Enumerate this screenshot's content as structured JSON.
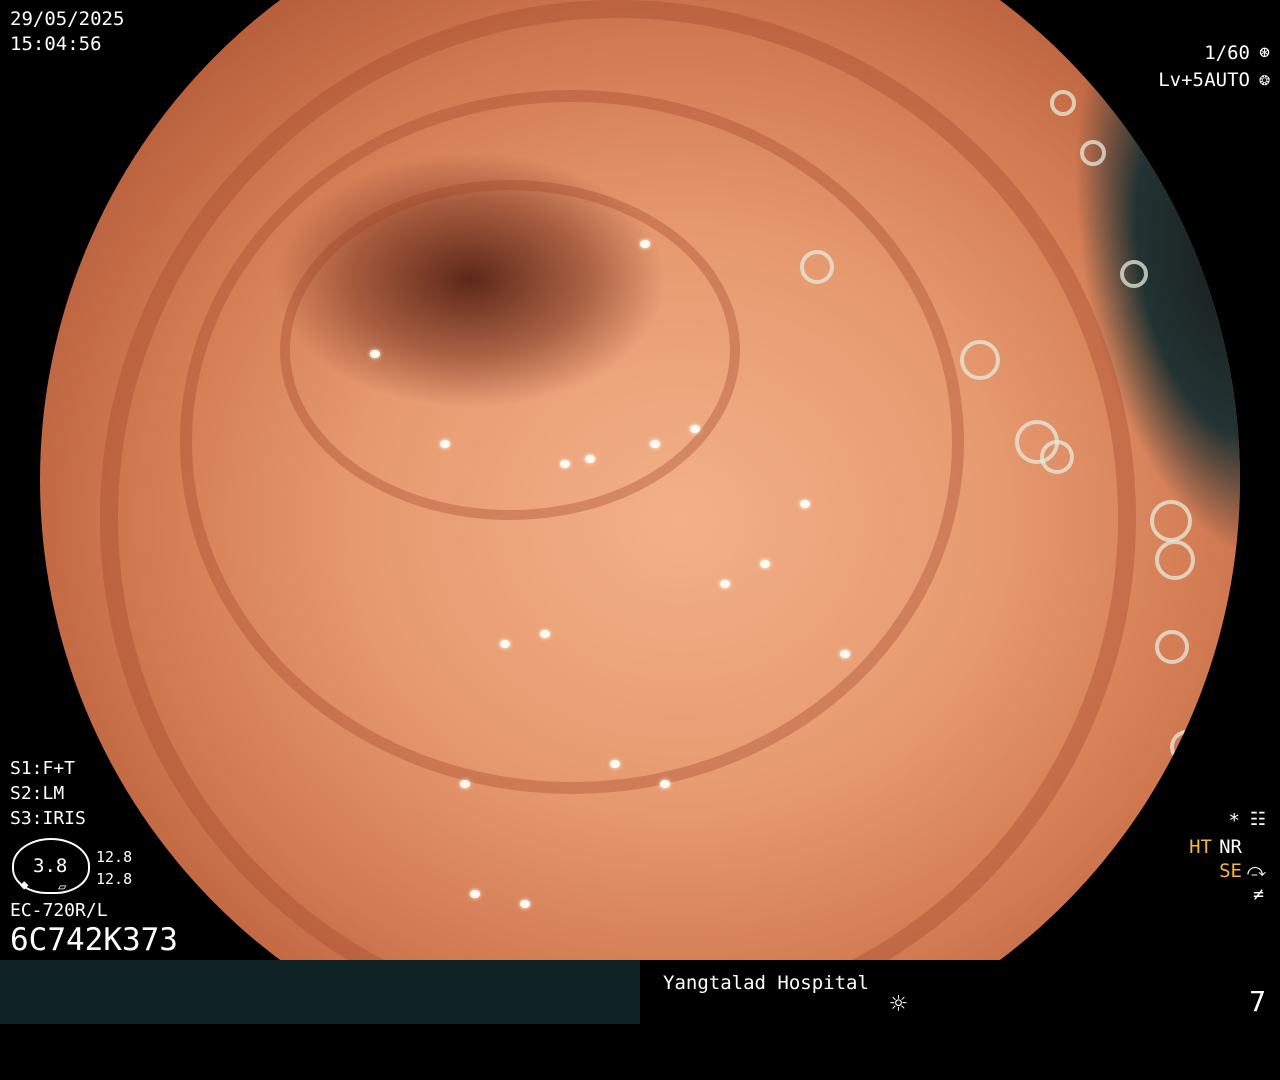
{
  "colors": {
    "background": "#000000",
    "bar_left": "#0f2326",
    "text": "#ffffff",
    "accent": "#f6b73c"
  },
  "overlay": {
    "date": "29/05/2025",
    "time": "15:04:56",
    "shutter": "1/60",
    "shutter_icon": "aperture-icon",
    "level": "Lv+5",
    "mode": "AUTO",
    "mode_icon": "iris-icon"
  },
  "settings": {
    "s1": "S1:F+T",
    "s2": "S2:LM",
    "s3": "S3:IRIS"
  },
  "gauge": {
    "value": "3.8",
    "upper": "12.8",
    "lower": "12.8"
  },
  "scope": {
    "model": "EC-720R/L",
    "serial": "6C742K373"
  },
  "indicators": {
    "asterisk": "*",
    "settings_icon": "menu-settings-icon",
    "ht": "HT",
    "nr": "NR",
    "se": "SE",
    "se_icon": "enhance-curve-icon",
    "freeze_icon": "not-equal-icon"
  },
  "footer": {
    "hospital": "Yangtalad Hospital",
    "brightness_icon": "sun-icon",
    "page": "7"
  }
}
